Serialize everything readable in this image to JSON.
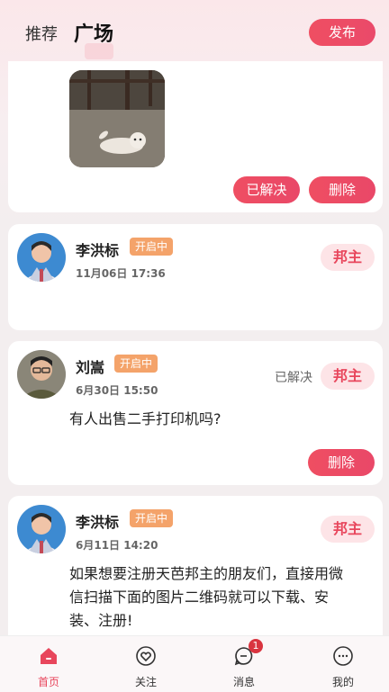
{
  "header": {
    "tab_recommend": "推荐",
    "tab_square": "广场",
    "publish_button": "发布"
  },
  "posts": [
    {
      "actions": [
        "已解决",
        "删除"
      ]
    },
    {
      "name": "李洪标",
      "badge": "开启中",
      "time": "11月06日 17:36",
      "role": "邦主"
    },
    {
      "name": "刘嵩",
      "badge": "开启中",
      "time": "6月30日 15:50",
      "status": "已解决",
      "role": "邦主",
      "text": "有人出售二手打印机吗?",
      "action": "删除"
    },
    {
      "name": "李洪标",
      "badge": "开启中",
      "time": "6月11日 14:20",
      "role": "邦主",
      "text_lines": [
        "如果想要注册天芭邦主的朋友们，直接用微",
        "信扫描下面的图片二维码就可以下载、安",
        "装、注册!"
      ]
    }
  ],
  "nav": [
    {
      "label": "首页",
      "icon": "home-icon",
      "active": true
    },
    {
      "label": "关注",
      "icon": "heart-icon"
    },
    {
      "label": "消息",
      "icon": "message-icon",
      "badge": "1"
    },
    {
      "label": "我的",
      "icon": "profile-icon"
    }
  ],
  "colors": {
    "accent": "#ea4a62",
    "badge": "#f4a36a",
    "role_bg": "#fde4e7"
  }
}
